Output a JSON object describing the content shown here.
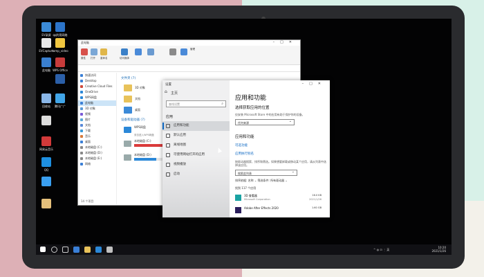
{
  "desktop_icons": [
    {
      "label": "EV录屏",
      "color": "#3b8bd8"
    },
    {
      "label": "qq利用网络",
      "color": "#2c74c9"
    },
    {
      "label": "EVCapture",
      "color": "#e8e8e8"
    },
    {
      "label": "tamp_video",
      "color": "#f0c640"
    },
    {
      "label": "WPS Office",
      "color": "#c73b3b"
    },
    {
      "label": "此电脑",
      "color": "#3a7fcf"
    },
    {
      "label": "",
      "color": "#2b5fa8"
    },
    {
      "label": "回收站",
      "color": "#8ab7e8"
    },
    {
      "label": "腾讯广广",
      "color": "#41a5e8"
    },
    {
      "label": "",
      "color": "#dddddd"
    },
    {
      "label": "网易云音乐",
      "color": "#d23a3a"
    },
    {
      "label": "QQ",
      "color": "#1e8fe0"
    },
    {
      "label": "",
      "color": "#3a9ff0"
    },
    {
      "label": "",
      "color": "#e5c07b"
    }
  ],
  "explorer": {
    "title": "此电脑",
    "ribbon_labels": [
      "属性",
      "打开",
      "重命名",
      "访问媒体",
      "映射网络驱动器",
      "添加一个网络位置",
      "打开设置",
      "管理"
    ],
    "nav": [
      "快速访问",
      "Desktop",
      "Creative Cloud Files",
      "OneDrive",
      "WPS网盘",
      "此电脑",
      "3D 对象",
      "视频",
      "图片",
      "文档",
      "下载",
      "音乐",
      "桌面",
      "本地磁盘 (C:)",
      "本地磁盘 (D:)",
      "本地磁盘 (E:)",
      "网络"
    ],
    "section_folders": "文件夹 (7)",
    "folders": [
      "3D 对象",
      "文档",
      "桌面"
    ],
    "section_drives": "设备和驱动器 (7)",
    "drives": [
      {
        "name": "WPS网盘",
        "sub": "双击进入WPS网盘",
        "fill": 0,
        "color": "#2b88d8"
      },
      {
        "name": "本地磁盘 (C:)",
        "sub": "",
        "fill": 0.92,
        "color": "#da3b3b"
      },
      {
        "name": "本地磁盘 (D:)",
        "sub": "",
        "fill": 0.35,
        "color": "#2b88d8"
      }
    ],
    "status": "14 个项目"
  },
  "settings": {
    "window_title": "设置",
    "home": "主页",
    "search_placeholder": "查找设置",
    "category": "应用",
    "side_items": [
      "应用和功能",
      "默认应用",
      "离线地图",
      "可使用网站打开的应用",
      "视频播放",
      "启动"
    ],
    "heading": "应用和功能",
    "sub_heading": "选择获取应用的位置",
    "desc1": "仅安装 Microsoft Store 中的应用有助于保护你的设备。",
    "dropdown1": "任何来源",
    "section2": "应用和功能",
    "link1": "可选功能",
    "link2": "应用执行别名",
    "desc2": "按驱动器搜索、排序和筛选。如果想要卸载或移动某个应用，请从列表中选择该应用。",
    "search2": "搜索此列表",
    "sort": "排序依据: 名称 ⌄    筛选条件: 所有驱动器 ⌄",
    "count": "找到 117 个应用",
    "app_name": "3D 查看器",
    "app_publisher": "Microsoft Corporation",
    "app_size": "16.0 KB",
    "app_date": "2021/1/26",
    "app2_name": "Adobe After Effects 2020",
    "app2_size": "1.60 GB"
  },
  "taskbar": {
    "time": "10:20",
    "date": "2021/1/26",
    "tray": "^  ◍  ⊡  ⋮  英"
  }
}
